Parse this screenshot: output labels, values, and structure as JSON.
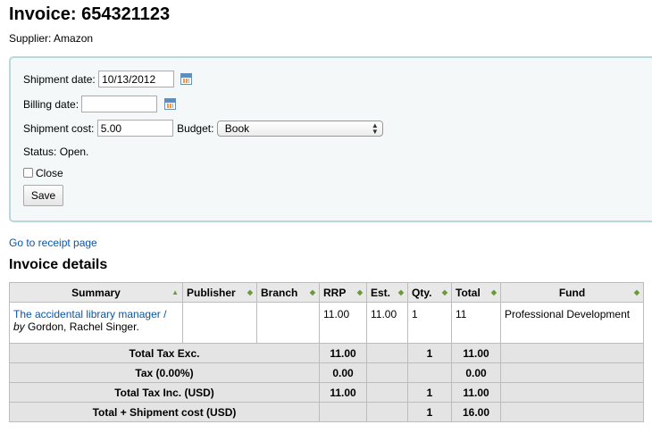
{
  "invoice": {
    "title": "Invoice: 654321123",
    "supplier": "Supplier: Amazon"
  },
  "form": {
    "shipment_date_label": "Shipment date:",
    "shipment_date_value": "10/13/2012",
    "billing_date_label": "Billing date:",
    "billing_date_value": "",
    "shipment_cost_label": "Shipment cost:",
    "shipment_cost_value": "5.00",
    "budget_label": "Budget:",
    "budget_value": "Book",
    "status": "Status: Open.",
    "close_label": "Close",
    "save_label": "Save"
  },
  "links": {
    "receipt": "Go to receipt page"
  },
  "details": {
    "heading": "Invoice details",
    "columns": [
      "Summary",
      "Publisher",
      "Branch",
      "RRP",
      "Est.",
      "Qty.",
      "Total",
      "Fund"
    ],
    "rows": [
      {
        "title": "The accidental library manager /",
        "by": "by",
        "author": "Gordon, Rachel Singer.",
        "publisher": "",
        "branch": "",
        "rrp": "11.00",
        "est": "11.00",
        "qty": "1",
        "total": "11",
        "fund": "Professional Development"
      }
    ],
    "footer": [
      {
        "label": "Total Tax Exc.",
        "rrp": "11.00",
        "est": "",
        "qty": "1",
        "total": "11.00",
        "fund": ""
      },
      {
        "label": "Tax (0.00%)",
        "rrp": "0.00",
        "est": "",
        "qty": "",
        "total": "0.00",
        "fund": ""
      },
      {
        "label": "Total Tax Inc. (USD)",
        "rrp": "11.00",
        "est": "",
        "qty": "1",
        "total": "11.00",
        "fund": ""
      },
      {
        "label": "Total + Shipment cost (USD)",
        "rrp": "",
        "est": "",
        "qty": "1",
        "total": "16.00",
        "fund": ""
      }
    ]
  },
  "icons": {
    "calendar": "calendar-icon",
    "sort": "sort-arrows-icon"
  }
}
